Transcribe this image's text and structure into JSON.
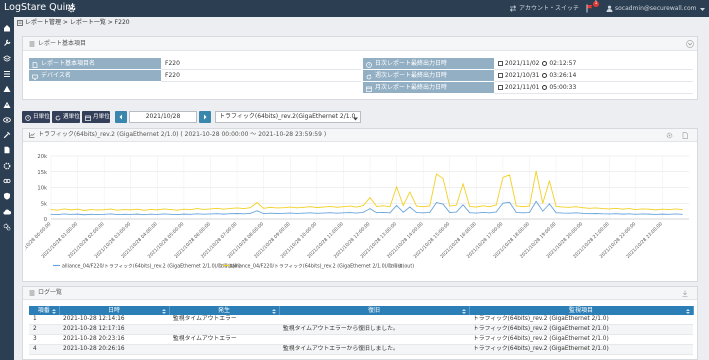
{
  "app": {
    "title": "LogStare Quint"
  },
  "header": {
    "account_switch": "アカウント・スイッチ",
    "notification_count": "1",
    "user_email": "socadmin@securewall.com"
  },
  "sidebar": {
    "icons": [
      "home-icon",
      "wrench-icon",
      "layers-icon",
      "list-icon",
      "warning-icon",
      "alert-icon",
      "eye-icon",
      "tools-icon",
      "document-icon",
      "gear-icon",
      "link-icon",
      "shield-icon",
      "cloud-icon",
      "cogs-icon"
    ]
  },
  "breadcrumb": "レポート管理 > レポート一覧 > F220",
  "info": {
    "title": "レポート基本項目",
    "rows": [
      {
        "label1": "レポート基本項目名",
        "value1": "F220",
        "label2": "日次レポート最終出力日時",
        "date": "2021/11/02",
        "time": "02:12:57"
      },
      {
        "label1": "デバイス名",
        "value1": "F220",
        "label2": "週次レポート最終出力日時",
        "date": "2021/10/31",
        "time": "03:26:14"
      },
      {
        "label1": "",
        "value1": "",
        "label2": "月次レポート最終出力日時",
        "date": "2021/11/01",
        "time": "05:00:33"
      }
    ]
  },
  "toolbar": {
    "day": "日単位",
    "week": "週単位",
    "month": "月単位",
    "date": "2021/10/28",
    "select_value": "トラフィック(64bits)_rev.2(GigaEthernet 2/1.0"
  },
  "chart_panel": {
    "title": "トラフィック(64bits)_rev.2 (GigaEthernet 2/1.0) ( 2021-10-28 00:00:00 ～ 2021-10-28 23:59:59 )"
  },
  "chart_data": {
    "type": "line",
    "ylim": [
      0,
      20000
    ],
    "grid": true,
    "legend": "bottom",
    "yticks": [
      {
        "value": 0,
        "label": "0"
      },
      {
        "value": 5000,
        "label": "5k"
      },
      {
        "value": 10000,
        "label": "10k"
      },
      {
        "value": 15000,
        "label": "15k"
      },
      {
        "value": 20000,
        "label": "20k"
      }
    ],
    "xticks": [
      "2021/10/28 00:00:00",
      "2021/10/28 01:00:00",
      "2021/10/28 02:00:00",
      "2021/10/28 03:00:00",
      "2021/10/28 04:00:00",
      "2021/10/28 05:00:00",
      "2021/10/28 06:00:00",
      "2021/10/28 07:00:00",
      "2021/10/28 08:00:00",
      "2021/10/28 09:00:00",
      "2021/10/28 10:00:00",
      "2021/10/28 11:00:00",
      "2021/10/28 12:00:00",
      "2021/10/28 13:00:00",
      "2021/10/28 14:00:00",
      "2021/10/28 15:00:00",
      "2021/10/28 16:00:00",
      "2021/10/28 17:00:00",
      "2021/10/28 18:00:00",
      "2021/10/28 19:00:00",
      "2021/10/28 20:00:00",
      "2021/10/28 21:00:00",
      "2021/10/28 22:00:00",
      "2021/10/28 23:00:00"
    ],
    "x": [
      "00:00",
      "00:15",
      "00:30",
      "00:45",
      "01:00",
      "01:15",
      "01:30",
      "01:45",
      "02:00",
      "02:15",
      "02:30",
      "02:45",
      "03:00",
      "03:15",
      "03:30",
      "03:45",
      "04:00",
      "04:15",
      "04:30",
      "04:45",
      "05:00",
      "05:15",
      "05:30",
      "05:45",
      "06:00",
      "06:15",
      "06:30",
      "06:45",
      "07:00",
      "07:15",
      "07:30",
      "07:45",
      "08:00",
      "08:15",
      "08:30",
      "08:45",
      "09:00",
      "09:15",
      "09:30",
      "09:45",
      "10:00",
      "10:15",
      "10:30",
      "10:45",
      "11:00",
      "11:15",
      "11:30",
      "11:45",
      "12:00",
      "12:15",
      "12:30",
      "12:45",
      "13:00",
      "13:15",
      "13:30",
      "13:45",
      "14:00",
      "14:15",
      "14:30",
      "14:45",
      "15:00",
      "15:15",
      "15:30",
      "15:45",
      "16:00",
      "16:15",
      "16:30",
      "16:45",
      "17:00",
      "17:15",
      "17:30",
      "17:45",
      "18:00",
      "18:15",
      "18:30",
      "18:45",
      "19:00",
      "19:15",
      "19:30",
      "19:45",
      "20:00",
      "20:15",
      "20:30",
      "20:45",
      "21:00",
      "21:15",
      "21:30",
      "21:45",
      "22:00",
      "22:15",
      "22:30",
      "22:45",
      "23:00",
      "23:15",
      "23:30",
      "23:45"
    ],
    "series": [
      {
        "name": "alliance_04/F220/トラフィック(64bits)_rev.2 (GigaEthernet 2/1.0)/取得値(in)",
        "color": "#6aa5dc",
        "values": [
          1500,
          1400,
          1600,
          1450,
          1550,
          1350,
          1500,
          1420,
          1480,
          1600,
          1400,
          1500,
          1450,
          1550,
          1380,
          1520,
          1450,
          1600,
          1500,
          1400,
          1550,
          1480,
          1650,
          1520,
          1600,
          1700,
          1550,
          1680,
          1750,
          1650,
          1800,
          2600,
          1700,
          1850,
          1750,
          1800,
          1900,
          1780,
          1850,
          1950,
          1820,
          1900,
          2000,
          1850,
          1950,
          2050,
          1900,
          2150,
          3300,
          2000,
          2100,
          1950,
          4300,
          2150,
          3800,
          2050,
          1950,
          2100,
          5200,
          4700,
          2050,
          2200,
          4500,
          2000,
          1900,
          2100,
          1950,
          2250,
          5000,
          5300,
          2100,
          1950,
          2050,
          5600,
          2500,
          4800,
          2000,
          1900,
          1850,
          1950,
          1800,
          1700,
          1750,
          1650,
          1600,
          1700,
          1550,
          1650,
          1500,
          1600,
          1550,
          1450,
          1550,
          1500,
          1600,
          1500
        ]
      },
      {
        "name": "alliance_04/F220/トラフィック(64bits)_rev.2 (GigaEthernet 2/1.0)/取得値(out)",
        "color": "#f2d024",
        "values": [
          3000,
          2800,
          3200,
          2900,
          3100,
          2700,
          3000,
          2850,
          2950,
          3150,
          2800,
          3000,
          2900,
          3100,
          2750,
          3050,
          2900,
          3200,
          3000,
          2800,
          3100,
          2950,
          3300,
          3050,
          3200,
          3400,
          3100,
          3350,
          3500,
          3300,
          3600,
          5200,
          3400,
          3700,
          3500,
          3600,
          3800,
          3550,
          3700,
          3900,
          3650,
          3800,
          4000,
          3700,
          3900,
          4100,
          3800,
          4300,
          6800,
          4000,
          4200,
          3900,
          10200,
          4300,
          8600,
          4100,
          3900,
          4200,
          14300,
          12800,
          4100,
          4400,
          11200,
          4000,
          3800,
          4200,
          3900,
          4500,
          13200,
          14000,
          4200,
          3900,
          4100,
          15200,
          5000,
          12100,
          4000,
          3800,
          3700,
          3900,
          3600,
          3400,
          3500,
          3300,
          3200,
          3400,
          3100,
          3300,
          3000,
          3200,
          3100,
          2900,
          3100,
          3000,
          3200,
          3000
        ]
      }
    ]
  },
  "log": {
    "title": "ログ一覧",
    "columns": [
      "項番",
      "日時",
      "発生",
      "復旧",
      "監視項目"
    ],
    "rows": [
      [
        "1",
        "2021-10-28 12:14:16",
        "監視タイムアウトエラー",
        "",
        "トラフィック(64bits)_rev.2 (GigaEthernet 2/1.0)"
      ],
      [
        "2",
        "2021-10-28 12:17:16",
        "",
        "監視タイムアウトエラーから復旧しました。",
        "トラフィック(64bits)_rev.2 (GigaEthernet 2/1.0)"
      ],
      [
        "3",
        "2021-10-28 20:23:16",
        "監視タイムアウトエラー",
        "",
        "トラフィック(64bits)_rev.2 (GigaEthernet 2/1.0)"
      ],
      [
        "4",
        "2021-10-28 20:26:16",
        "",
        "監視タイムアウトエラーから復旧しました。",
        "トラフィック(64bits)_rev.2 (GigaEthernet 2/1.0)"
      ]
    ]
  },
  "colors": {
    "topbar": "#2c3e52",
    "label_cell": "#93afc4",
    "table_header": "#2c7eb6",
    "button": "#34405a",
    "nav_arrow": "#3a87ad"
  }
}
